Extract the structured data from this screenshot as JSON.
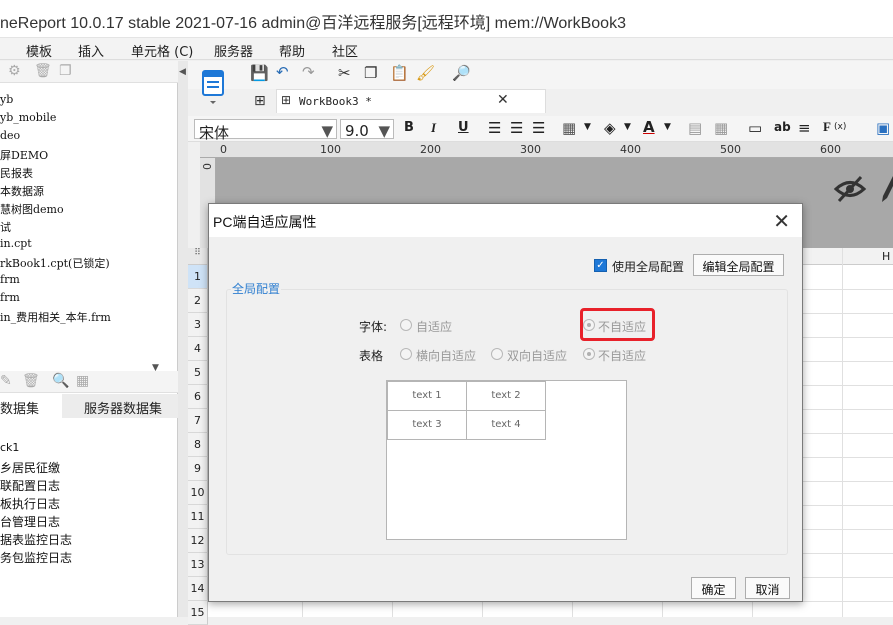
{
  "window": {
    "title": "neReport 10.0.17 stable 2021-07-16 admin@百洋远程服务[远程环境]    mem://WorkBook3"
  },
  "menu": [
    "模板",
    "插入",
    "单元格 (C)",
    "服务器",
    "帮助",
    "社区"
  ],
  "left_panel": {
    "tree_items": [
      "yb",
      "yb_mobile",
      "deo",
      "屏DEMO",
      "民报表",
      "本数据源",
      "慧树图demo",
      "试",
      "in.cpt",
      "rkBook1.cpt(已锁定)",
      "frm",
      "frm",
      "in_费用相关_本年.frm"
    ],
    "ds_tabs": [
      "数据集",
      "服务器数据集"
    ],
    "ds_items": [
      "ck1",
      "乡居民征缴",
      "联配置日志",
      "板执行日志",
      "台管理日志",
      "据表监控日志",
      "务包监控日志"
    ]
  },
  "doc_tab": {
    "label": "WorkBook3 *"
  },
  "format_bar": {
    "font": "宋体",
    "size": "9.0"
  },
  "ruler": [
    "0",
    "100",
    "200",
    "300",
    "400",
    "500",
    "600"
  ],
  "vruler": "0",
  "grid": {
    "rows": [
      "1",
      "2",
      "3",
      "4",
      "5",
      "6",
      "7",
      "8",
      "9",
      "10",
      "11",
      "12",
      "13",
      "14",
      "15"
    ],
    "col_H": "H"
  },
  "dialog": {
    "title": "PC端自适应属性",
    "use_global_label": "使用全局配置",
    "use_global_checked": true,
    "edit_global_label": "编辑全局配置",
    "group_title": "全局配置",
    "font_label": "字体:",
    "font_options": [
      "自适应",
      "不自适应"
    ],
    "font_selected": "不自适应",
    "table_label": "表格",
    "table_options": [
      "横向自适应",
      "双向自适应",
      "不自适应"
    ],
    "table_selected": "不自适应",
    "preview_cells": [
      "text 1",
      "text 2",
      "text 3",
      "text 4"
    ],
    "ok_label": "确定",
    "cancel_label": "取消"
  },
  "colors": {
    "accent": "#1e78d7",
    "highlight": "#e8212a",
    "group_title": "#2f7fd0"
  }
}
